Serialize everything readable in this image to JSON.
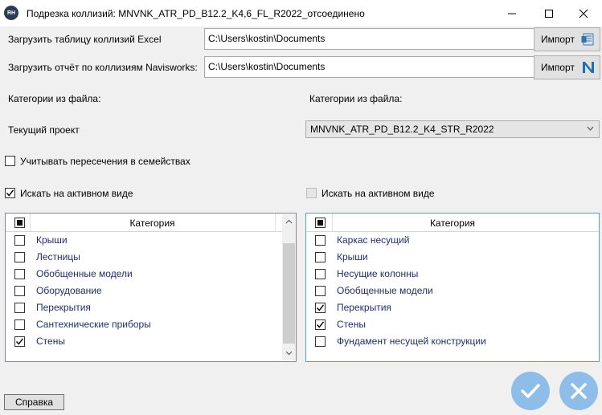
{
  "window": {
    "title": "Подрезка коллизий: MNVNK_ATR_PD_B12.2_K4,6_FL_R2022_отсоединено",
    "logo": "RH",
    "minimize_icon": "minimize-icon",
    "maximize_icon": "maximize-icon",
    "close_icon": "close-icon"
  },
  "excel": {
    "label": "Загрузить таблицу коллизий Excel",
    "path": "C:\\Users\\kostin\\Documents",
    "button": "Импорт",
    "icon": "excel-icon"
  },
  "navis": {
    "label": "Загрузить отчёт по коллизиям Navisworks:",
    "path": "C:\\Users\\kostin\\Documents",
    "button": "Импорт",
    "icon": "navisworks-icon"
  },
  "left": {
    "categories_label": "Категории из файла:",
    "project_label": "Текущий проект",
    "families_checkbox": {
      "label": "Учитывать пересечения в семействах",
      "checked": false
    },
    "active_view_checkbox": {
      "label": "Искать на активном виде",
      "checked": true
    },
    "table": {
      "header": "Категория",
      "items": [
        {
          "label": "Крыши",
          "checked": false
        },
        {
          "label": "Лестницы",
          "checked": false
        },
        {
          "label": "Обобщенные модели",
          "checked": false
        },
        {
          "label": "Оборудование",
          "checked": false
        },
        {
          "label": "Перекрытия",
          "checked": false
        },
        {
          "label": "Сантехнические приборы",
          "checked": false
        },
        {
          "label": "Стены",
          "checked": true
        }
      ]
    }
  },
  "right": {
    "categories_label": "Категории из файла:",
    "project_select": "MNVNK_ATR_PD_B12.2_K4_STR_R2022",
    "active_view_checkbox": {
      "label": "Искать на активном виде",
      "checked": false,
      "disabled": true
    },
    "table": {
      "header": "Категория",
      "items": [
        {
          "label": "Каркас несущий",
          "checked": false
        },
        {
          "label": "Крыши",
          "checked": false
        },
        {
          "label": "Несущие колонны",
          "checked": false
        },
        {
          "label": "Обобщенные модели",
          "checked": false
        },
        {
          "label": "Перекрытия",
          "checked": true
        },
        {
          "label": "Стены",
          "checked": true
        },
        {
          "label": "Фундамент несущей конструкции",
          "checked": false
        }
      ]
    }
  },
  "footer": {
    "help": "Справка",
    "ok_icon": "check-icon",
    "cancel_icon": "cancel-icon"
  },
  "colors": {
    "accent": "#8dbde8",
    "link_text": "#1f2f6b",
    "panel_border": "#569de5"
  }
}
